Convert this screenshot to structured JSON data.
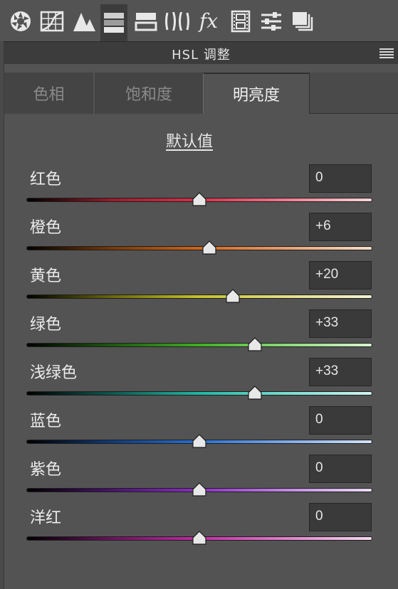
{
  "toolbar": {
    "icons": [
      {
        "name": "aperture-icon"
      },
      {
        "name": "tone-curve-icon"
      },
      {
        "name": "detail-icon"
      },
      {
        "name": "hsl-icon"
      },
      {
        "name": "split-toning-icon"
      },
      {
        "name": "lens-corrections-icon"
      },
      {
        "name": "fx-icon",
        "label": "fx"
      },
      {
        "name": "camera-calibration-icon"
      },
      {
        "name": "presets-icon"
      },
      {
        "name": "snapshots-icon"
      }
    ]
  },
  "header": {
    "title": "HSL 调整"
  },
  "tabs": [
    {
      "label": "色相",
      "active": false
    },
    {
      "label": "饱和度",
      "active": false
    },
    {
      "label": "明亮度",
      "active": true
    }
  ],
  "default_label": "默认值",
  "sliders": [
    {
      "label": "红色",
      "value": "0",
      "numeric": 0,
      "gradient": [
        "#000000",
        "#9a1d2c",
        "#d9304a",
        "#f07a90",
        "#ffd6dc"
      ]
    },
    {
      "label": "橙色",
      "value": "+6",
      "numeric": 6,
      "gradient": [
        "#000000",
        "#7a3a08",
        "#d0651a",
        "#e8a070",
        "#f6ddc8"
      ]
    },
    {
      "label": "黄色",
      "value": "+20",
      "numeric": 20,
      "gradient": [
        "#000000",
        "#6b6a0a",
        "#c6c22a",
        "#e3df86",
        "#f4f3d4"
      ]
    },
    {
      "label": "绿色",
      "value": "+33",
      "numeric": 33,
      "gradient": [
        "#000000",
        "#1d5a10",
        "#3fae24",
        "#8cd87a",
        "#d8f3cf"
      ]
    },
    {
      "label": "浅绿色",
      "value": "+33",
      "numeric": 33,
      "gradient": [
        "#000000",
        "#0d5a50",
        "#1fb9a4",
        "#78ddd0",
        "#d0f5ef"
      ]
    },
    {
      "label": "蓝色",
      "value": "0",
      "numeric": 0,
      "gradient": [
        "#000000",
        "#113a78",
        "#2a6fd0",
        "#7fa9e6",
        "#d4e2f8"
      ]
    },
    {
      "label": "紫色",
      "value": "0",
      "numeric": 0,
      "gradient": [
        "#000000",
        "#4a1470",
        "#8d2dc8",
        "#c087e2",
        "#eadcf6"
      ]
    },
    {
      "label": "洋红",
      "value": "0",
      "numeric": 0,
      "gradient": [
        "#000000",
        "#6e1260",
        "#c42aa8",
        "#e080cc",
        "#f6d8ef"
      ]
    }
  ],
  "slider_range": [
    -100,
    100
  ]
}
